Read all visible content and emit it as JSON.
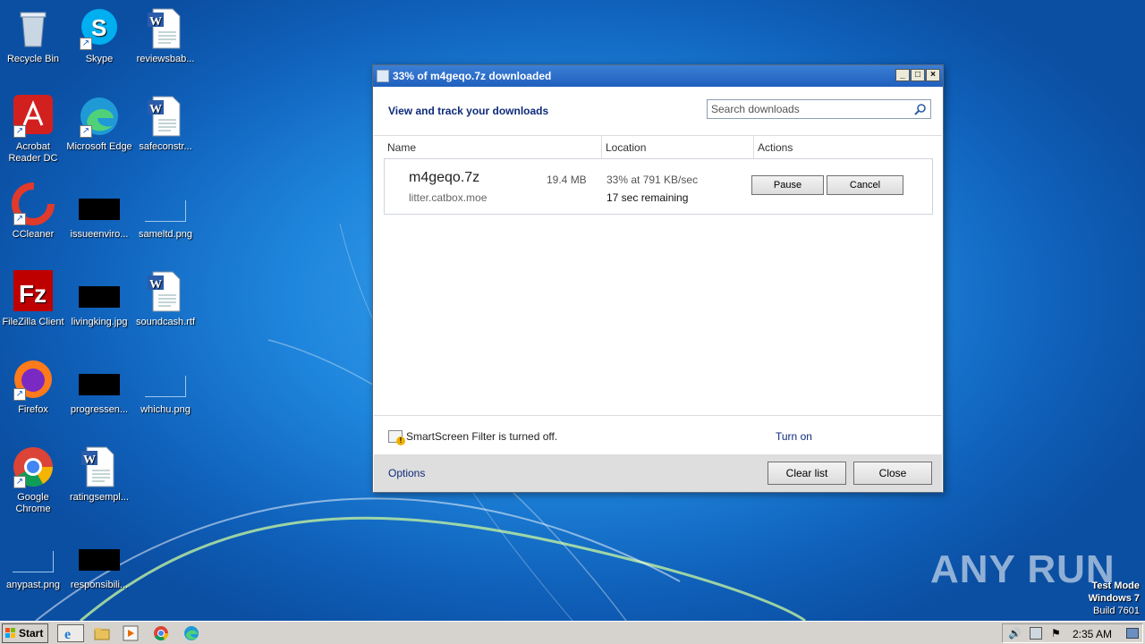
{
  "desktop": {
    "icons": [
      {
        "label": "Recycle Bin",
        "icon": "recycle-bin-icon"
      },
      {
        "label": "Skype",
        "icon": "skype-icon"
      },
      {
        "label": "reviewsbab...",
        "icon": "word-document-icon"
      },
      {
        "label": "Acrobat Reader DC",
        "icon": "acrobat-icon"
      },
      {
        "label": "Microsoft Edge",
        "icon": "edge-icon"
      },
      {
        "label": "safeconstr...",
        "icon": "word-document-icon"
      },
      {
        "label": "CCleaner",
        "icon": "ccleaner-icon"
      },
      {
        "label": "issueenviro...",
        "icon": "black-thumbnail-icon"
      },
      {
        "label": "sameltd.png",
        "icon": "image-thumbnail-icon"
      },
      {
        "label": "FileZilla Client",
        "icon": "filezilla-icon"
      },
      {
        "label": "livingking.jpg",
        "icon": "black-thumbnail-icon"
      },
      {
        "label": "soundcash.rtf",
        "icon": "word-document-icon"
      },
      {
        "label": "Firefox",
        "icon": "firefox-icon"
      },
      {
        "label": "progressen...",
        "icon": "black-thumbnail-icon"
      },
      {
        "label": "whichu.png",
        "icon": "image-thumbnail-icon"
      },
      {
        "label": "Google Chrome",
        "icon": "chrome-icon"
      },
      {
        "label": "ratingsempl...",
        "icon": "word-document-icon"
      },
      {
        "label": "anypast.png",
        "icon": "image-thumbnail-icon"
      },
      {
        "label": "responsibili...",
        "icon": "black-thumbnail-icon"
      }
    ]
  },
  "dialog": {
    "title": "33% of m4geqo.7z downloaded",
    "subtitle": "View and track your downloads",
    "search_placeholder": "Search downloads",
    "columns": [
      "Name",
      "Location",
      "Actions"
    ],
    "download": {
      "filename": "m4geqo.7z",
      "size": "19.4 MB",
      "source": "litter.catbox.moe",
      "progress_text": "33% at 791 KB/sec",
      "remaining": "17 sec remaining",
      "progress": 0.33,
      "pause_label": "Pause",
      "cancel_label": "Cancel"
    },
    "smartscreen_text": "SmartScreen Filter is turned off.",
    "turn_on_label": "Turn on",
    "options_label": "Options",
    "clear_list_label": "Clear list",
    "close_label": "Close"
  },
  "watermark": {
    "brand": "ANY RUN",
    "test_mode": "Test Mode",
    "os": "Windows 7",
    "build": "Build 7601"
  },
  "taskbar": {
    "start_label": "Start",
    "clock": "2:35 AM"
  }
}
